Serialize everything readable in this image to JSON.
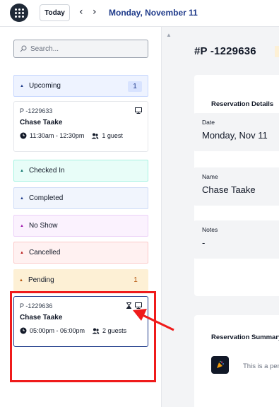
{
  "header": {
    "today_label": "Today",
    "prev_icon": "chevron-left-icon",
    "next_icon": "chevron-right-icon",
    "date": "Monday, November 11"
  },
  "sidebar": {
    "search": {
      "placeholder": "Search...",
      "value": ""
    },
    "groups": [
      {
        "label": "Upcoming",
        "count": "1",
        "color": "#1e3a8a"
      },
      {
        "label": "Checked In",
        "count": "",
        "color": "#0f766e"
      },
      {
        "label": "Completed",
        "count": "",
        "color": "#1e3a8a"
      },
      {
        "label": "No Show",
        "count": "",
        "color": "#a21caf"
      },
      {
        "label": "Cancelled",
        "count": "",
        "color": "#b91c1c"
      },
      {
        "label": "Pending",
        "count": "1",
        "color": "#b45309"
      }
    ],
    "upcoming_reservation": {
      "code": "P -1229633",
      "name": "Chase Taake",
      "time": "11:30am - 12:30pm",
      "guests": "1 guest"
    },
    "pending_reservation": {
      "code": "P -1229636",
      "name": "Chase Taake",
      "time": "05:00pm - 06:00pm",
      "guests": "2 guests"
    }
  },
  "detail": {
    "reservation_id": "#P -1229636",
    "details_title": "Reservation Details",
    "fields": [
      {
        "label": "Date",
        "value": "Monday, Nov 11"
      },
      {
        "label": "Name",
        "value": "Chase Taake"
      },
      {
        "label": "Notes",
        "value": "-"
      }
    ],
    "summary_title": "Reservation Summary",
    "summary_text": "This is a pending reservation"
  },
  "colors": {
    "highlight": "#ef1b1b",
    "accent": "#1e3a8a"
  }
}
